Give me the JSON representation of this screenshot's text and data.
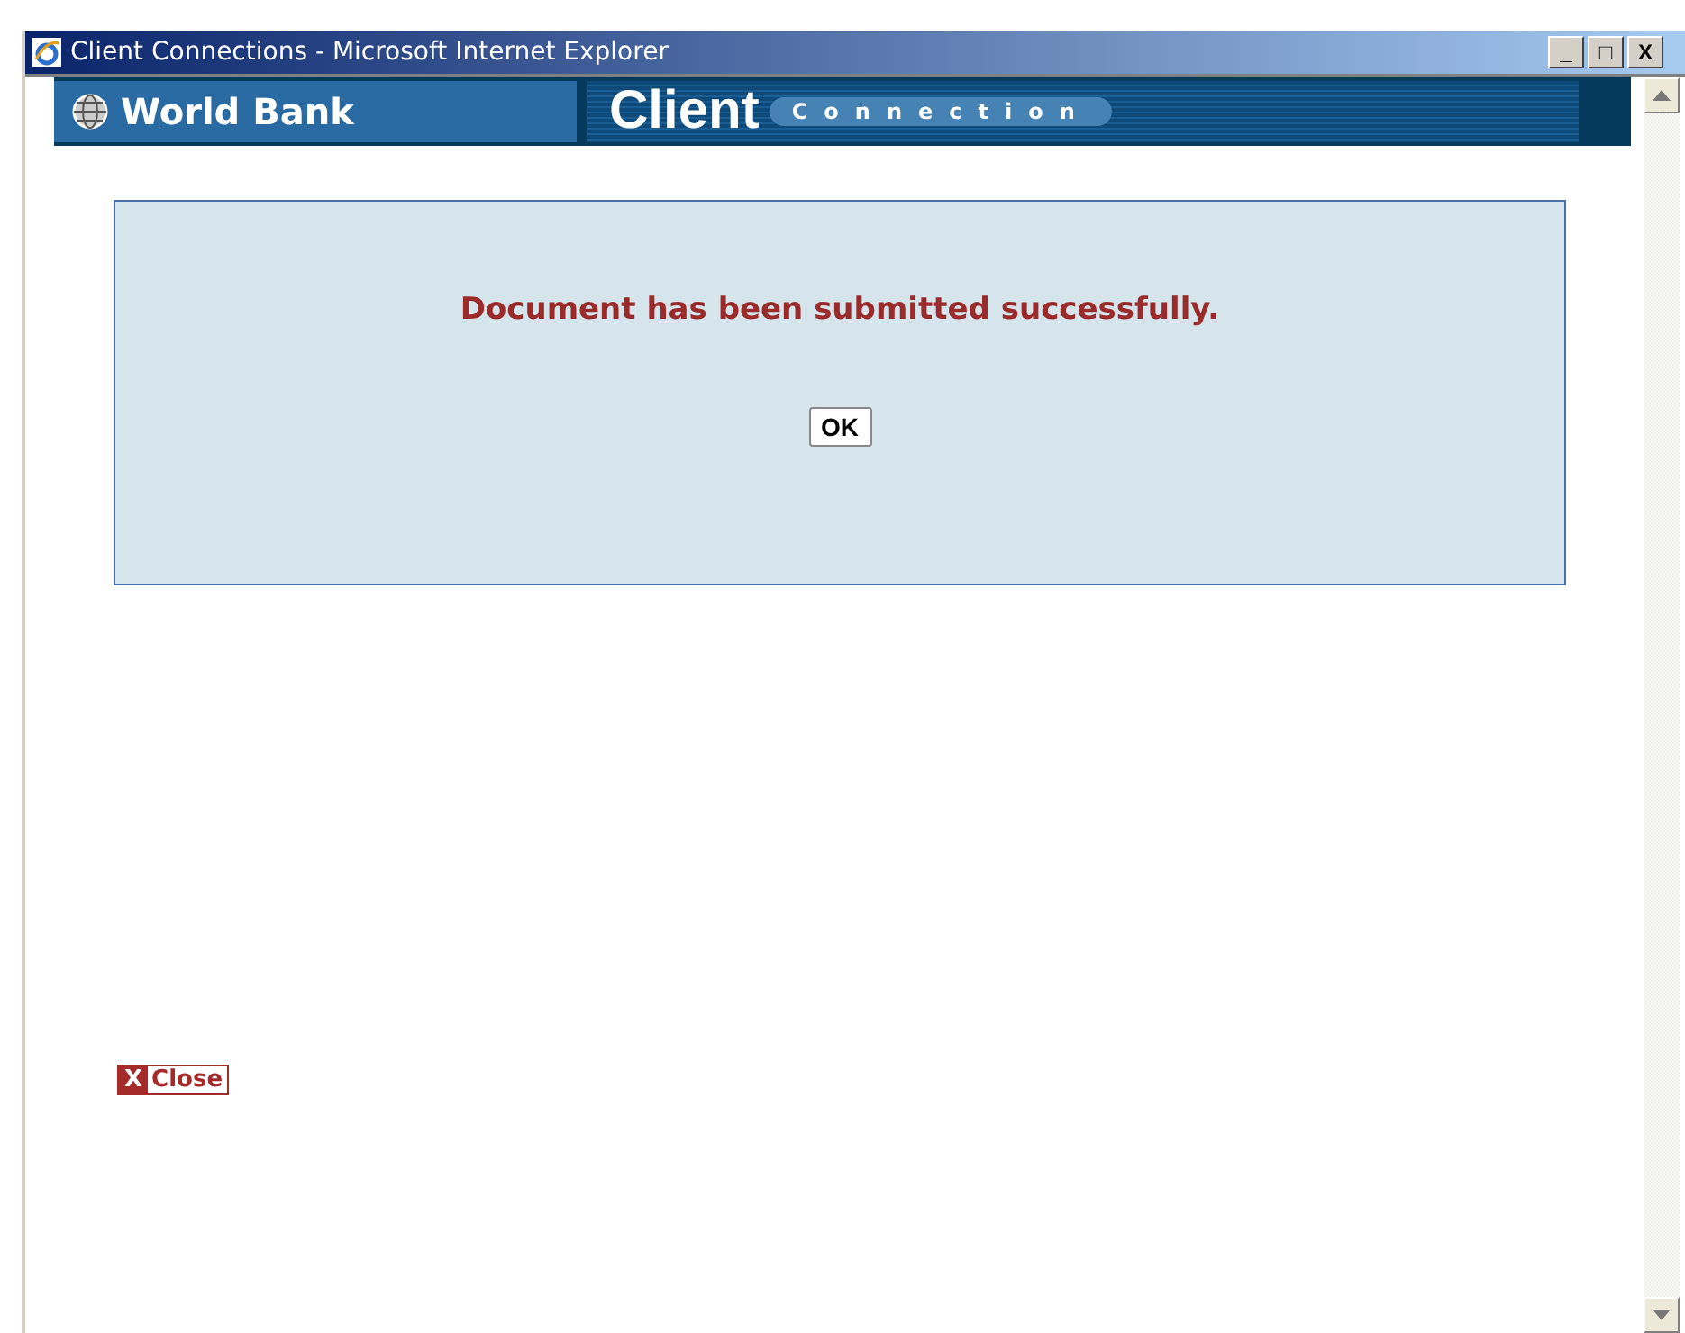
{
  "window": {
    "title": "Client Connections - Microsoft Internet Explorer",
    "buttons": [
      "_",
      "□",
      "X"
    ]
  },
  "banner": {
    "left": "World Bank",
    "brand": "Client",
    "tagline": "Connection"
  },
  "message": {
    "text": "Document has been submitted successfully.",
    "button": "OK"
  },
  "close_link": {
    "icon": "X",
    "label": "Close"
  }
}
